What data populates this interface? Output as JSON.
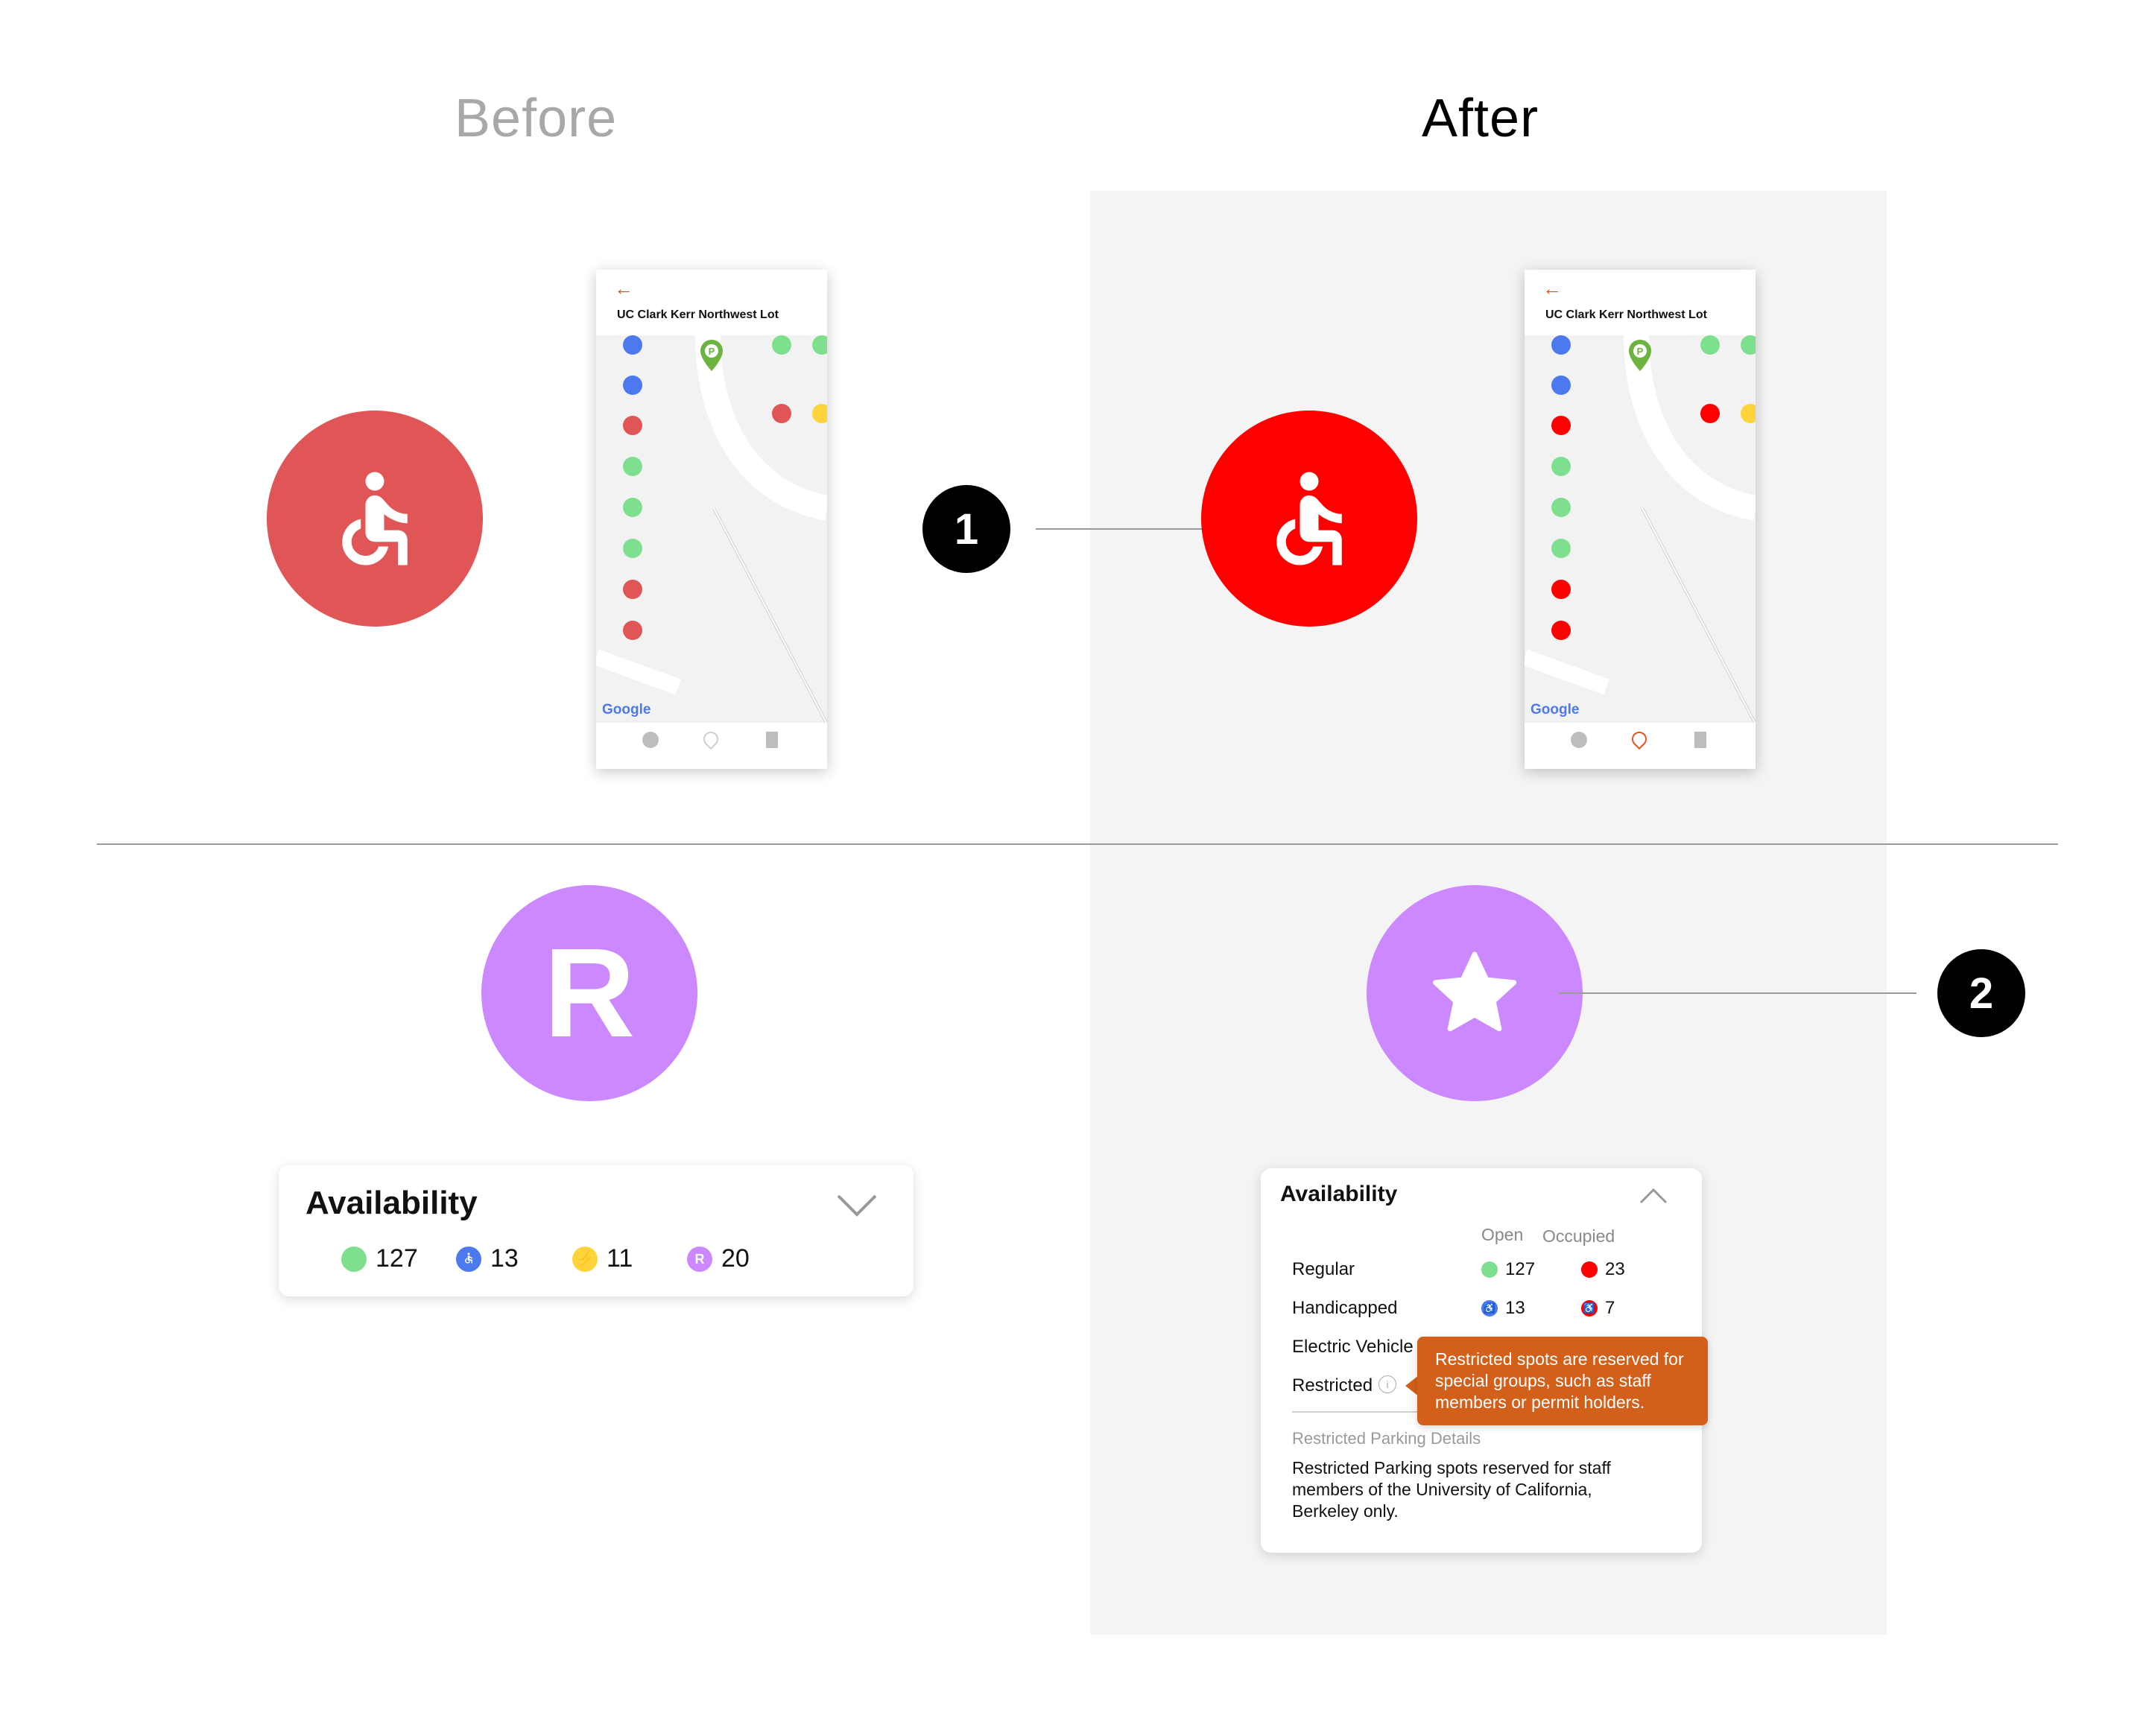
{
  "headings": {
    "before": "Before",
    "after": "After"
  },
  "badges": {
    "one": "1",
    "two": "2"
  },
  "icons": {
    "before_r_letter": "R"
  },
  "colors": {
    "before_red": "#e05555",
    "after_red": "#ff0000",
    "purple": "#cc88ff",
    "green": "#7ee08f",
    "blue": "#4d79ef",
    "yellow": "#ffd43b",
    "tooltip": "#d2601a",
    "back_arrow": "#e0531f"
  },
  "phone_before": {
    "title": "UC Clark Kerr Northwest Lot",
    "map_credit": "Google"
  },
  "phone_after": {
    "title": "UC Clark Kerr Northwest Lot",
    "map_credit": "Google"
  },
  "availability_before": {
    "title": "Availability",
    "items": [
      {
        "type": "regular",
        "count": "127"
      },
      {
        "type": "handicapped",
        "count": "13"
      },
      {
        "type": "electric",
        "count": "11"
      },
      {
        "type": "restricted",
        "icon_letter": "R",
        "count": "20"
      }
    ]
  },
  "availability_after": {
    "title": "Availability",
    "columns": {
      "open": "Open",
      "occupied": "Occupied"
    },
    "rows": {
      "regular": {
        "label": "Regular",
        "open": "127",
        "occupied": "23"
      },
      "handicapped": {
        "label": "Handicapped",
        "open": "13",
        "occupied": "7"
      },
      "electric": {
        "label": "Electric Vehicle"
      },
      "restricted": {
        "label": "Restricted"
      }
    },
    "tooltip": "Restricted spots are reserved for special groups, such as staff members or permit holders.",
    "details_label": "Restricted Parking Details",
    "details_text": "Restricted Parking spots reserved for staff members of the University of California, Berkeley only."
  }
}
